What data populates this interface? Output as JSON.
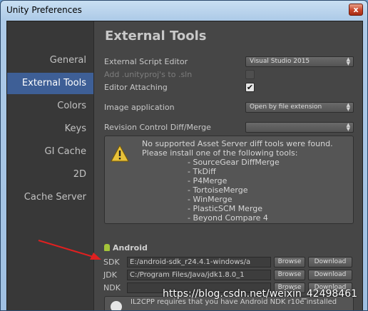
{
  "window": {
    "title": "Unity Preferences",
    "close_glyph": "x"
  },
  "sidebar": {
    "items": [
      {
        "label": "General",
        "selected": false
      },
      {
        "label": "External Tools",
        "selected": true
      },
      {
        "label": "Colors",
        "selected": false
      },
      {
        "label": "Keys",
        "selected": false
      },
      {
        "label": "GI Cache",
        "selected": false
      },
      {
        "label": "2D",
        "selected": false
      },
      {
        "label": "Cache Server",
        "selected": false
      }
    ]
  },
  "main": {
    "heading": "External Tools",
    "external_script_editor": {
      "label": "External Script Editor",
      "value": "Visual Studio 2015"
    },
    "add_unityproj": {
      "label": "Add .unityproj's to .sln",
      "checked": false,
      "disabled": true
    },
    "editor_attaching": {
      "label": "Editor Attaching",
      "checked": true,
      "check_glyph": "✔"
    },
    "image_application": {
      "label": "Image application",
      "value": "Open by file extension"
    },
    "revision_control": {
      "label": "Revision Control Diff/Merge",
      "value": ""
    },
    "help": {
      "title": "No supported Asset Server diff tools were found. Please install one of the following tools:",
      "tools": [
        "- SourceGear DiffMerge",
        "- TkDiff",
        "- P4Merge",
        "- TortoiseMerge",
        "- WinMerge",
        "- PlasticSCM Merge",
        "- Beyond Compare 4"
      ]
    },
    "android": {
      "header": "Android",
      "sdk": {
        "label": "SDK",
        "value": "E:/android-sdk_r24.4.1-windows/a",
        "browse": "Browse",
        "download": "Download"
      },
      "jdk": {
        "label": "JDK",
        "value": "C:/Program Files/Java/jdk1.8.0_1",
        "browse": "Browse",
        "download": "Download"
      },
      "ndk": {
        "label": "NDK",
        "value": "",
        "browse": "Browse",
        "download": "Download"
      },
      "il2cpp_note": "IL2CPP requires that you have Android NDK r10e installed"
    }
  },
  "watermark": "https://blog.csdn.net/weixin_42498461",
  "colors": {
    "selection": "#3e5f96",
    "annotation_arrow": "#e02020"
  }
}
